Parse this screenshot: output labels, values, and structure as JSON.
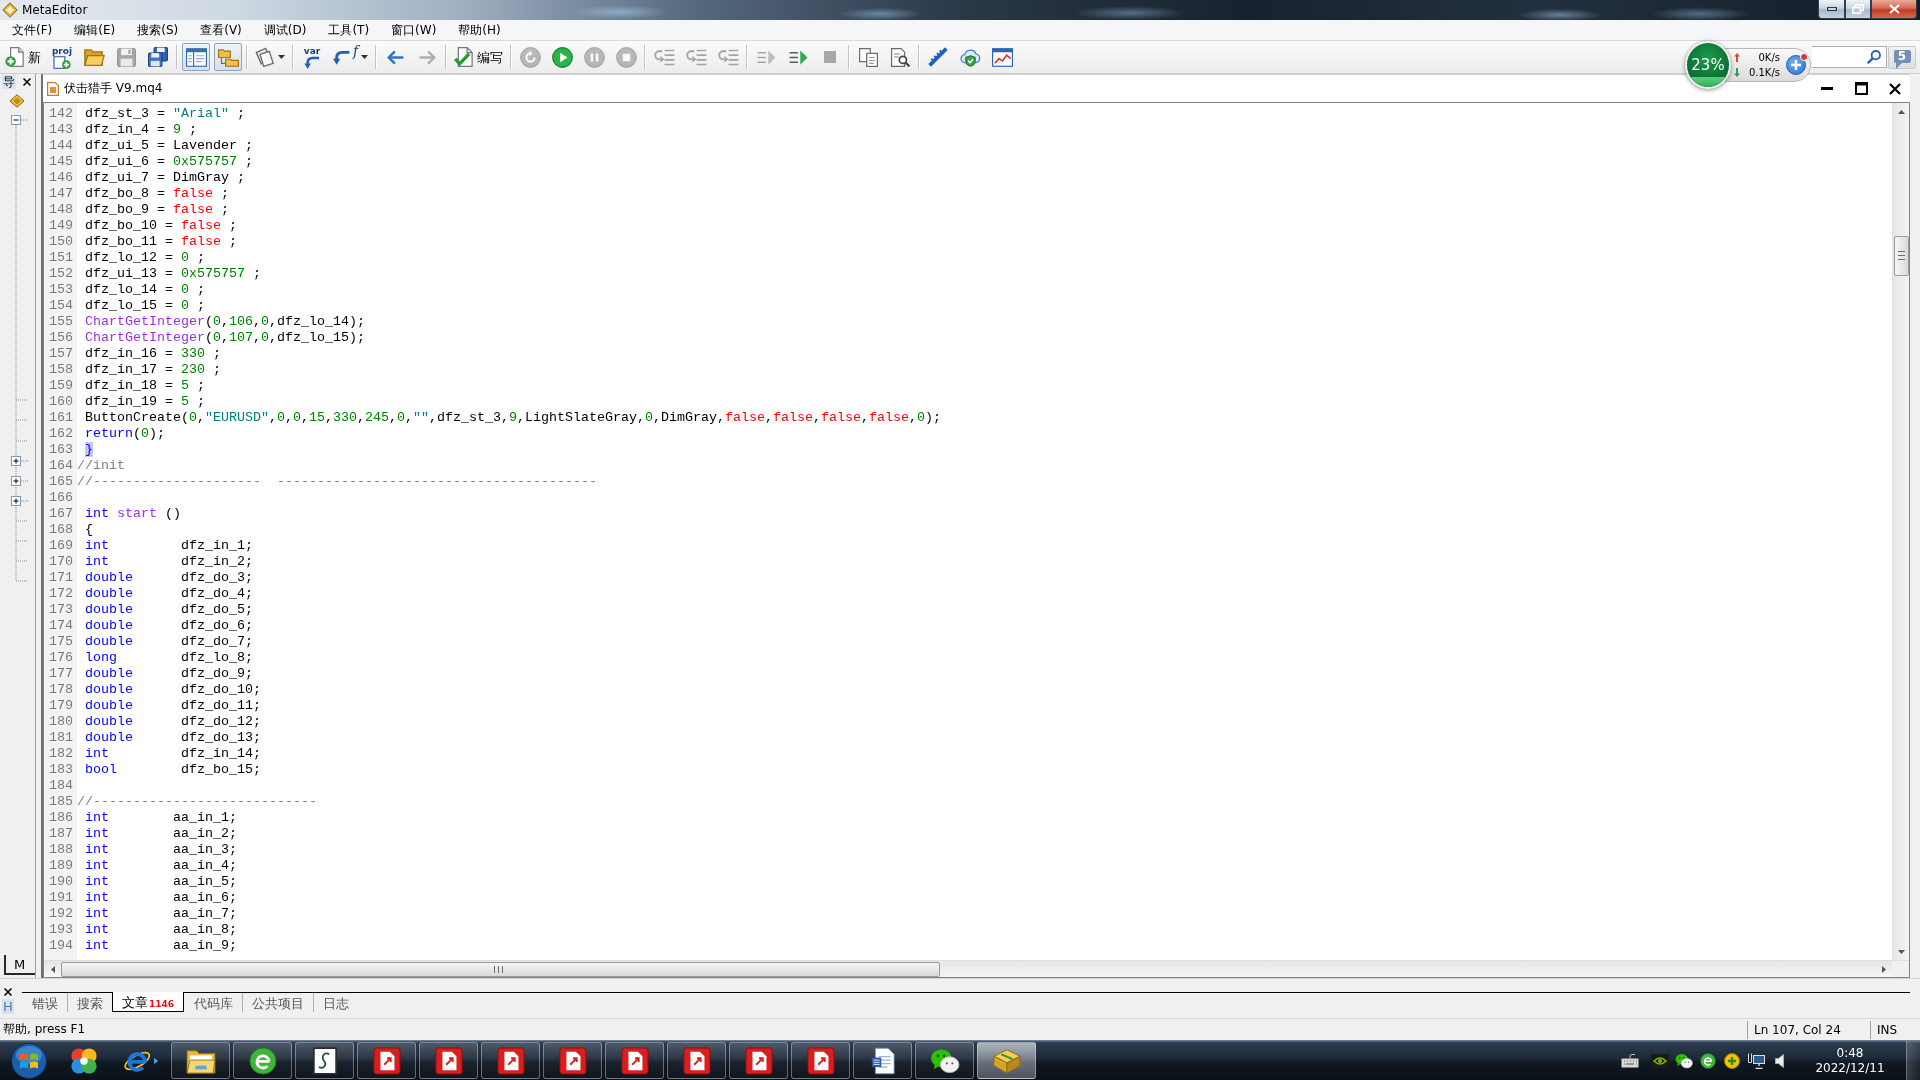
{
  "window": {
    "title": "MetaEditor"
  },
  "menu": [
    "文件(F)",
    "编辑(E)",
    "搜索(S)",
    "查看(V)",
    "调试(D)",
    "工具(T)",
    "窗口(W)",
    "帮助(H)"
  ],
  "toolbar": {
    "groups": [
      [
        {
          "kind": "button",
          "label": "新",
          "disabled": false
        },
        {
          "kind": "button",
          "label": "proj",
          "disabled": false
        },
        {
          "kind": "button",
          "disabled": false
        },
        {
          "kind": "button",
          "disabled": true
        },
        {
          "kind": "button",
          "disabled": false
        }
      ],
      [
        {
          "kind": "toggle",
          "pressed": true,
          "disabled": false
        },
        {
          "kind": "toggle",
          "pressed": true,
          "disabled": false
        }
      ],
      [
        {
          "kind": "dropdown",
          "disabled": false
        }
      ],
      [
        {
          "kind": "button",
          "label": "var",
          "disabled": false
        },
        {
          "kind": "dropdown",
          "label": "f",
          "disabled": false
        }
      ],
      [
        {
          "kind": "button",
          "disabled": false
        },
        {
          "kind": "button",
          "disabled": true
        }
      ],
      [
        {
          "kind": "button",
          "label": "编写",
          "disabled": false
        }
      ],
      [
        {
          "kind": "button",
          "disabled": true
        },
        {
          "kind": "button",
          "disabled": false
        },
        {
          "kind": "button",
          "disabled": true
        },
        {
          "kind": "button",
          "disabled": true
        }
      ],
      [
        {
          "kind": "button",
          "disabled": true
        },
        {
          "kind": "button",
          "disabled": true
        },
        {
          "kind": "button",
          "disabled": true
        }
      ],
      [
        {
          "kind": "button",
          "disabled": true
        },
        {
          "kind": "button",
          "disabled": false
        },
        {
          "kind": "button",
          "disabled": true
        }
      ],
      [
        {
          "kind": "button",
          "disabled": false
        },
        {
          "kind": "button",
          "disabled": false
        }
      ],
      [
        {
          "kind": "button",
          "disabled": false
        },
        {
          "kind": "button",
          "disabled": false
        },
        {
          "kind": "button",
          "disabled": false
        }
      ]
    ],
    "message_count": "5"
  },
  "speed_widget": {
    "memory": {
      "reading": "23%",
      "level": 0.23
    },
    "upload": "0K/s",
    "download": "0.1K/s"
  },
  "navigator": {
    "title": "导",
    "tab": "M"
  },
  "document": {
    "title": "伏击猎手 V9.mq4",
    "lines": [
      {
        "number": "142",
        "tokens": [
          {
            "text": " dfz_st_3 = ",
            "kind": "plain"
          },
          {
            "text": "\"Arial\"",
            "kind": "string"
          },
          {
            "text": " ;",
            "kind": "plain"
          }
        ]
      },
      {
        "number": "143",
        "tokens": [
          {
            "text": " dfz_in_4 = ",
            "kind": "plain"
          },
          {
            "text": "9",
            "kind": "number"
          },
          {
            "text": " ;",
            "kind": "plain"
          }
        ]
      },
      {
        "number": "144",
        "tokens": [
          {
            "text": " dfz_ui_5 = Lavender ;",
            "kind": "plain"
          }
        ]
      },
      {
        "number": "145",
        "tokens": [
          {
            "text": " dfz_ui_6 = ",
            "kind": "plain"
          },
          {
            "text": "0x575757",
            "kind": "number"
          },
          {
            "text": " ;",
            "kind": "plain"
          }
        ]
      },
      {
        "number": "146",
        "tokens": [
          {
            "text": " dfz_ui_7 = DimGray ;",
            "kind": "plain"
          }
        ]
      },
      {
        "number": "147",
        "tokens": [
          {
            "text": " dfz_bo_8 = ",
            "kind": "plain"
          },
          {
            "text": "false",
            "kind": "constant"
          },
          {
            "text": " ;",
            "kind": "plain"
          }
        ]
      },
      {
        "number": "148",
        "tokens": [
          {
            "text": " dfz_bo_9 = ",
            "kind": "plain"
          },
          {
            "text": "false",
            "kind": "constant"
          },
          {
            "text": " ;",
            "kind": "plain"
          }
        ]
      },
      {
        "number": "149",
        "tokens": [
          {
            "text": " dfz_bo_10 = ",
            "kind": "plain"
          },
          {
            "text": "false",
            "kind": "constant"
          },
          {
            "text": " ;",
            "kind": "plain"
          }
        ]
      },
      {
        "number": "150",
        "tokens": [
          {
            "text": " dfz_bo_11 = ",
            "kind": "plain"
          },
          {
            "text": "false",
            "kind": "constant"
          },
          {
            "text": " ;",
            "kind": "plain"
          }
        ]
      },
      {
        "number": "151",
        "tokens": [
          {
            "text": " dfz_lo_12 = ",
            "kind": "plain"
          },
          {
            "text": "0",
            "kind": "number"
          },
          {
            "text": " ;",
            "kind": "plain"
          }
        ]
      },
      {
        "number": "152",
        "tokens": [
          {
            "text": " dfz_ui_13 = ",
            "kind": "plain"
          },
          {
            "text": "0x575757",
            "kind": "number"
          },
          {
            "text": " ;",
            "kind": "plain"
          }
        ]
      },
      {
        "number": "153",
        "tokens": [
          {
            "text": " dfz_lo_14 = ",
            "kind": "plain"
          },
          {
            "text": "0",
            "kind": "number"
          },
          {
            "text": " ;",
            "kind": "plain"
          }
        ]
      },
      {
        "number": "154",
        "tokens": [
          {
            "text": " dfz_lo_15 = ",
            "kind": "plain"
          },
          {
            "text": "0",
            "kind": "number"
          },
          {
            "text": " ;",
            "kind": "plain"
          }
        ]
      },
      {
        "number": "155",
        "tokens": [
          {
            "text": " ChartGetInteger",
            "kind": "function"
          },
          {
            "text": "(",
            "kind": "plain"
          },
          {
            "text": "0",
            "kind": "number"
          },
          {
            "text": ",",
            "kind": "plain"
          },
          {
            "text": "106",
            "kind": "number"
          },
          {
            "text": ",",
            "kind": "plain"
          },
          {
            "text": "0",
            "kind": "number"
          },
          {
            "text": ",dfz_lo_14);",
            "kind": "plain"
          }
        ]
      },
      {
        "number": "156",
        "tokens": [
          {
            "text": " ChartGetInteger",
            "kind": "function"
          },
          {
            "text": "(",
            "kind": "plain"
          },
          {
            "text": "0",
            "kind": "number"
          },
          {
            "text": ",",
            "kind": "plain"
          },
          {
            "text": "107",
            "kind": "number"
          },
          {
            "text": ",",
            "kind": "plain"
          },
          {
            "text": "0",
            "kind": "number"
          },
          {
            "text": ",dfz_lo_15);",
            "kind": "plain"
          }
        ]
      },
      {
        "number": "157",
        "tokens": [
          {
            "text": " dfz_in_16 = ",
            "kind": "plain"
          },
          {
            "text": "330",
            "kind": "number"
          },
          {
            "text": " ;",
            "kind": "plain"
          }
        ]
      },
      {
        "number": "158",
        "tokens": [
          {
            "text": " dfz_in_17 = ",
            "kind": "plain"
          },
          {
            "text": "230",
            "kind": "number"
          },
          {
            "text": " ;",
            "kind": "plain"
          }
        ]
      },
      {
        "number": "159",
        "tokens": [
          {
            "text": " dfz_in_18 = ",
            "kind": "plain"
          },
          {
            "text": "5",
            "kind": "number"
          },
          {
            "text": " ;",
            "kind": "plain"
          }
        ]
      },
      {
        "number": "160",
        "tokens": [
          {
            "text": " dfz_in_19 = ",
            "kind": "plain"
          },
          {
            "text": "5",
            "kind": "number"
          },
          {
            "text": " ;",
            "kind": "plain"
          }
        ]
      },
      {
        "number": "161",
        "tokens": [
          {
            "text": " ButtonCreate(",
            "kind": "plain"
          },
          {
            "text": "0",
            "kind": "number"
          },
          {
            "text": ",",
            "kind": "plain"
          },
          {
            "text": "\"EURUSD\"",
            "kind": "string"
          },
          {
            "text": ",",
            "kind": "plain"
          },
          {
            "text": "0",
            "kind": "number"
          },
          {
            "text": ",",
            "kind": "plain"
          },
          {
            "text": "0",
            "kind": "number"
          },
          {
            "text": ",",
            "kind": "plain"
          },
          {
            "text": "15",
            "kind": "number"
          },
          {
            "text": ",",
            "kind": "plain"
          },
          {
            "text": "330",
            "kind": "number"
          },
          {
            "text": ",",
            "kind": "plain"
          },
          {
            "text": "245",
            "kind": "number"
          },
          {
            "text": ",",
            "kind": "plain"
          },
          {
            "text": "0",
            "kind": "number"
          },
          {
            "text": ",",
            "kind": "plain"
          },
          {
            "text": "\"\"",
            "kind": "string"
          },
          {
            "text": ",dfz_st_3,",
            "kind": "plain"
          },
          {
            "text": "9",
            "kind": "number"
          },
          {
            "text": ",LightSlateGray,",
            "kind": "plain"
          },
          {
            "text": "0",
            "kind": "number"
          },
          {
            "text": ",DimGray,",
            "kind": "plain"
          },
          {
            "text": "false",
            "kind": "constant"
          },
          {
            "text": ",",
            "kind": "plain"
          },
          {
            "text": "false",
            "kind": "constant"
          },
          {
            "text": ",",
            "kind": "plain"
          },
          {
            "text": "false",
            "kind": "constant"
          },
          {
            "text": ",",
            "kind": "plain"
          },
          {
            "text": "false",
            "kind": "constant"
          },
          {
            "text": ",",
            "kind": "plain"
          },
          {
            "text": "0",
            "kind": "number"
          },
          {
            "text": ");",
            "kind": "plain"
          }
        ]
      },
      {
        "number": "162",
        "tokens": [
          {
            "text": " return",
            "kind": "keyword"
          },
          {
            "text": "(",
            "kind": "plain"
          },
          {
            "text": "0",
            "kind": "number"
          },
          {
            "text": ");",
            "kind": "plain"
          }
        ]
      },
      {
        "number": "163",
        "tokens": [
          {
            "text": " }",
            "kind": "brace"
          }
        ]
      },
      {
        "number": "164",
        "tokens": [
          {
            "text": "//init",
            "kind": "comment"
          }
        ]
      },
      {
        "number": "165",
        "tokens": [
          {
            "text": "//---------------------  ----------------------------------------",
            "kind": "comment"
          }
        ]
      },
      {
        "number": "166"
      },
      {
        "number": "167",
        "tokens": [
          {
            "text": " int",
            "kind": "keyword"
          },
          {
            "text": " start",
            "kind": "function"
          },
          {
            "text": " ()",
            "kind": "plain"
          }
        ]
      },
      {
        "number": "168",
        "tokens": [
          {
            "text": " {",
            "kind": "plain"
          }
        ]
      },
      {
        "number": "169",
        "tokens": [
          {
            "text": " int",
            "kind": "keyword"
          },
          {
            "text": "         dfz_in_1;",
            "kind": "plain"
          }
        ]
      },
      {
        "number": "170",
        "tokens": [
          {
            "text": " int",
            "kind": "keyword"
          },
          {
            "text": "         dfz_in_2;",
            "kind": "plain"
          }
        ]
      },
      {
        "number": "171",
        "tokens": [
          {
            "text": " double",
            "kind": "keyword"
          },
          {
            "text": "      dfz_do_3;",
            "kind": "plain"
          }
        ]
      },
      {
        "number": "172",
        "tokens": [
          {
            "text": " double",
            "kind": "keyword"
          },
          {
            "text": "      dfz_do_4;",
            "kind": "plain"
          }
        ]
      },
      {
        "number": "173",
        "tokens": [
          {
            "text": " double",
            "kind": "keyword"
          },
          {
            "text": "      dfz_do_5;",
            "kind": "plain"
          }
        ]
      },
      {
        "number": "174",
        "tokens": [
          {
            "text": " double",
            "kind": "keyword"
          },
          {
            "text": "      dfz_do_6;",
            "kind": "plain"
          }
        ]
      },
      {
        "number": "175",
        "tokens": [
          {
            "text": " double",
            "kind": "keyword"
          },
          {
            "text": "      dfz_do_7;",
            "kind": "plain"
          }
        ]
      },
      {
        "number": "176",
        "tokens": [
          {
            "text": " long",
            "kind": "keyword"
          },
          {
            "text": "        dfz_lo_8;",
            "kind": "plain"
          }
        ]
      },
      {
        "number": "177",
        "tokens": [
          {
            "text": " double",
            "kind": "keyword"
          },
          {
            "text": "      dfz_do_9;",
            "kind": "plain"
          }
        ]
      },
      {
        "number": "178",
        "tokens": [
          {
            "text": " double",
            "kind": "keyword"
          },
          {
            "text": "      dfz_do_10;",
            "kind": "plain"
          }
        ]
      },
      {
        "number": "179",
        "tokens": [
          {
            "text": " double",
            "kind": "keyword"
          },
          {
            "text": "      dfz_do_11;",
            "kind": "plain"
          }
        ]
      },
      {
        "number": "180",
        "tokens": [
          {
            "text": " double",
            "kind": "keyword"
          },
          {
            "text": "      dfz_do_12;",
            "kind": "plain"
          }
        ]
      },
      {
        "number": "181",
        "tokens": [
          {
            "text": " double",
            "kind": "keyword"
          },
          {
            "text": "      dfz_do_13;",
            "kind": "plain"
          }
        ]
      },
      {
        "number": "182",
        "tokens": [
          {
            "text": " int",
            "kind": "keyword"
          },
          {
            "text": "         dfz_in_14;",
            "kind": "plain"
          }
        ]
      },
      {
        "number": "183",
        "tokens": [
          {
            "text": " bool",
            "kind": "keyword"
          },
          {
            "text": "        dfz_bo_15;",
            "kind": "plain"
          }
        ]
      },
      {
        "number": "184"
      },
      {
        "number": "185",
        "tokens": [
          {
            "text": "//----------------------------",
            "kind": "comment"
          }
        ]
      },
      {
        "number": "186",
        "tokens": [
          {
            "text": " int",
            "kind": "keyword"
          },
          {
            "text": "        aa_in_1;",
            "kind": "plain"
          }
        ]
      },
      {
        "number": "187",
        "tokens": [
          {
            "text": " int",
            "kind": "keyword"
          },
          {
            "text": "        aa_in_2;",
            "kind": "plain"
          }
        ]
      },
      {
        "number": "188",
        "tokens": [
          {
            "text": " int",
            "kind": "keyword"
          },
          {
            "text": "        aa_in_3;",
            "kind": "plain"
          }
        ]
      },
      {
        "number": "189",
        "tokens": [
          {
            "text": " int",
            "kind": "keyword"
          },
          {
            "text": "        aa_in_4;",
            "kind": "plain"
          }
        ]
      },
      {
        "number": "190",
        "tokens": [
          {
            "text": " int",
            "kind": "keyword"
          },
          {
            "text": "        aa_in_5;",
            "kind": "plain"
          }
        ]
      },
      {
        "number": "191",
        "tokens": [
          {
            "text": " int",
            "kind": "keyword"
          },
          {
            "text": "        aa_in_6;",
            "kind": "plain"
          }
        ]
      },
      {
        "number": "192",
        "tokens": [
          {
            "text": " int",
            "kind": "keyword"
          },
          {
            "text": "        aa_in_7;",
            "kind": "plain"
          }
        ]
      },
      {
        "number": "193",
        "tokens": [
          {
            "text": " int",
            "kind": "keyword"
          },
          {
            "text": "        aa_in_8;",
            "kind": "plain"
          }
        ]
      },
      {
        "number": "194",
        "tokens": [
          {
            "text": " int",
            "kind": "keyword"
          },
          {
            "text": "        aa_in_9;",
            "kind": "plain"
          }
        ]
      }
    ]
  },
  "bottom_panel": {
    "side_label": "H",
    "tabs": [
      {
        "label": "错误",
        "selected": false
      },
      {
        "label": "搜索",
        "selected": false
      },
      {
        "label": "文章",
        "badge": "1146",
        "selected": true
      },
      {
        "label": "代码库",
        "selected": false
      },
      {
        "label": "公共项目",
        "selected": false
      },
      {
        "label": "日志",
        "selected": false
      }
    ]
  },
  "status_bar": {
    "hint": "帮助, press F1",
    "position": "Ln 107, Col 24",
    "mode": "INS"
  },
  "taskbar": {
    "apps": [
      {
        "running": false,
        "selected": false
      },
      {
        "running": false,
        "selected": false
      },
      {
        "running": true,
        "selected": false
      },
      {
        "running": true,
        "selected": false
      },
      {
        "running": true,
        "selected": false
      },
      {
        "running": true,
        "selected": false
      },
      {
        "running": true,
        "selected": false
      },
      {
        "running": true,
        "selected": false
      },
      {
        "running": true,
        "selected": false
      },
      {
        "running": true,
        "selected": false
      },
      {
        "running": true,
        "selected": false
      },
      {
        "running": true,
        "selected": false
      },
      {
        "running": true,
        "selected": false
      },
      {
        "running": true,
        "selected": false
      },
      {
        "running": true,
        "selected": false
      },
      {
        "running": true,
        "selected": true
      }
    ],
    "clock": {
      "time": "0:48",
      "date": "2022/12/11"
    }
  }
}
